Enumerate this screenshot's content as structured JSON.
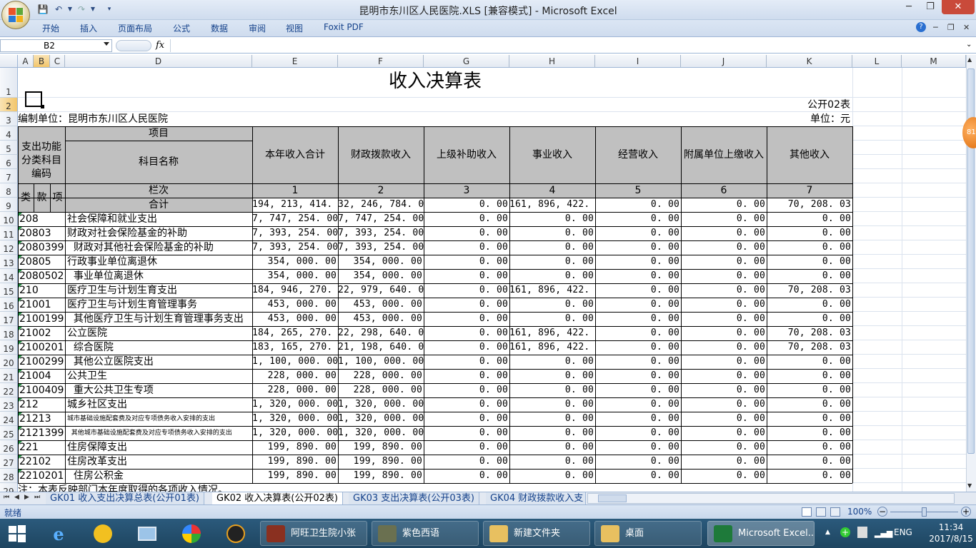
{
  "window": {
    "title": "昆明市东川区人民医院.XLS  [兼容模式] - Microsoft Excel"
  },
  "ribbon": {
    "tabs": [
      "开始",
      "插入",
      "页面布局",
      "公式",
      "数据",
      "审阅",
      "视图",
      "Foxit PDF"
    ]
  },
  "formula_bar": {
    "name_box": "B2",
    "fx_label": "fx",
    "formula": ""
  },
  "columns": [
    "A",
    "B",
    "C",
    "D",
    "E",
    "F",
    "G",
    "H",
    "I",
    "J",
    "K",
    "L",
    "M"
  ],
  "selected_cell": {
    "column": "B",
    "row": "2"
  },
  "sheet": {
    "title": "收入决算表",
    "code": "公开02表",
    "org": "编制单位：昆明市东川区人民医院",
    "unit": "单位：元",
    "header": {
      "item": "项目",
      "func_code": "支出功能分类科目编码",
      "subject_name": "科目名称",
      "lei": "类",
      "kuan": "款",
      "xiang": "项",
      "lanci": "栏次",
      "heji": "合计",
      "cols": [
        "本年收入合计",
        "财政拨款收入",
        "上级补助收入",
        "事业收入",
        "经营收入",
        "附属单位上缴收入",
        "其他收入"
      ],
      "col_nums": [
        "1",
        "2",
        "3",
        "4",
        "5",
        "6",
        "7"
      ]
    },
    "total_row": [
      "194, 213, 414. 50",
      "32, 246, 784. 00",
      "0. 00",
      "161, 896, 422. 47",
      "0. 00",
      "0. 00",
      "70, 208. 03"
    ],
    "rows": [
      {
        "code": "208",
        "name": "社会保障和就业支出",
        "vals": [
          "7, 747, 254. 00",
          "7, 747, 254. 00",
          "0. 00",
          "0. 00",
          "0. 00",
          "0. 00",
          "0. 00"
        ]
      },
      {
        "code": "20803",
        "name": "财政对社会保险基金的补助",
        "vals": [
          "7, 393, 254. 00",
          "7, 393, 254. 00",
          "0. 00",
          "0. 00",
          "0. 00",
          "0. 00",
          "0. 00"
        ]
      },
      {
        "code": "2080399",
        "name": "  财政对其他社会保险基金的补助",
        "vals": [
          "7, 393, 254. 00",
          "7, 393, 254. 00",
          "0. 00",
          "0. 00",
          "0. 00",
          "0. 00",
          "0. 00"
        ]
      },
      {
        "code": "20805",
        "name": "行政事业单位离退休",
        "vals": [
          "354, 000. 00",
          "354, 000. 00",
          "0. 00",
          "0. 00",
          "0. 00",
          "0. 00",
          "0. 00"
        ]
      },
      {
        "code": "2080502",
        "name": "  事业单位离退休",
        "vals": [
          "354, 000. 00",
          "354, 000. 00",
          "0. 00",
          "0. 00",
          "0. 00",
          "0. 00",
          "0. 00"
        ]
      },
      {
        "code": "210",
        "name": "医疗卫生与计划生育支出",
        "vals": [
          "184, 946, 270. 50",
          "22, 979, 640. 00",
          "0. 00",
          "161, 896, 422. 47",
          "0. 00",
          "0. 00",
          "70, 208. 03"
        ]
      },
      {
        "code": "21001",
        "name": "医疗卫生与计划生育管理事务",
        "vals": [
          "453, 000. 00",
          "453, 000. 00",
          "0. 00",
          "0. 00",
          "0. 00",
          "0. 00",
          "0. 00"
        ]
      },
      {
        "code": "2100199",
        "name": "  其他医疗卫生与计划生育管理事务支出",
        "vals": [
          "453, 000. 00",
          "453, 000. 00",
          "0. 00",
          "0. 00",
          "0. 00",
          "0. 00",
          "0. 00"
        ]
      },
      {
        "code": "21002",
        "name": "公立医院",
        "vals": [
          "184, 265, 270. 50",
          "22, 298, 640. 00",
          "0. 00",
          "161, 896, 422. 47",
          "0. 00",
          "0. 00",
          "70, 208. 03"
        ]
      },
      {
        "code": "2100201",
        "name": "  综合医院",
        "vals": [
          "183, 165, 270. 50",
          "21, 198, 640. 00",
          "0. 00",
          "161, 896, 422. 47",
          "0. 00",
          "0. 00",
          "70, 208. 03"
        ]
      },
      {
        "code": "2100299",
        "name": "  其他公立医院支出",
        "vals": [
          "1, 100, 000. 00",
          "1, 100, 000. 00",
          "0. 00",
          "0. 00",
          "0. 00",
          "0. 00",
          "0. 00"
        ]
      },
      {
        "code": "21004",
        "name": "公共卫生",
        "vals": [
          "228, 000. 00",
          "228, 000. 00",
          "0. 00",
          "0. 00",
          "0. 00",
          "0. 00",
          "0. 00"
        ]
      },
      {
        "code": "2100409",
        "name": "  重大公共卫生专项",
        "vals": [
          "228, 000. 00",
          "228, 000. 00",
          "0. 00",
          "0. 00",
          "0. 00",
          "0. 00",
          "0. 00"
        ]
      },
      {
        "code": "212",
        "name": "城乡社区支出",
        "vals": [
          "1, 320, 000. 00",
          "1, 320, 000. 00",
          "0. 00",
          "0. 00",
          "0. 00",
          "0. 00",
          "0. 00"
        ]
      },
      {
        "code": "21213",
        "name": "城市基础设施配套费及对应专项债务收入安排的支出",
        "small": true,
        "vals": [
          "1, 320, 000. 00",
          "1, 320, 000. 00",
          "0. 00",
          "0. 00",
          "0. 00",
          "0. 00",
          "0. 00"
        ]
      },
      {
        "code": "2121399",
        "name": "  其他城市基础设施配套费及对应专项债务收入安排的支出",
        "small": true,
        "vals": [
          "1, 320, 000. 00",
          "1, 320, 000. 00",
          "0. 00",
          "0. 00",
          "0. 00",
          "0. 00",
          "0. 00"
        ]
      },
      {
        "code": "221",
        "name": "住房保障支出",
        "vals": [
          "199, 890. 00",
          "199, 890. 00",
          "0. 00",
          "0. 00",
          "0. 00",
          "0. 00",
          "0. 00"
        ]
      },
      {
        "code": "22102",
        "name": "住房改革支出",
        "vals": [
          "199, 890. 00",
          "199, 890. 00",
          "0. 00",
          "0. 00",
          "0. 00",
          "0. 00",
          "0. 00"
        ]
      },
      {
        "code": "2210201",
        "name": "  住房公积金",
        "vals": [
          "199, 890. 00",
          "199, 890. 00",
          "0. 00",
          "0. 00",
          "0. 00",
          "0. 00",
          "0. 00"
        ]
      }
    ],
    "note": "注：本表反映部门本年度取得的各项收入情况。"
  },
  "row_numbers": [
    "1",
    "2",
    "3",
    "4",
    "5",
    "6",
    "7",
    "8",
    "9",
    "10",
    "11",
    "12",
    "13",
    "14",
    "15",
    "16",
    "17",
    "18",
    "19",
    "20",
    "21",
    "22",
    "23",
    "24",
    "25",
    "26",
    "27",
    "28",
    "29"
  ],
  "sheet_tabs": [
    "GK01 收入支出决算总表(公开01表)",
    "GK02 收入决算表(公开02表)",
    "GK03 支出决算表(公开03表)",
    "GK04 财政拨款收入支"
  ],
  "active_sheet_tab": 1,
  "status": {
    "ready": "就绪",
    "zoom": "100%"
  },
  "taskbar": {
    "tasks": [
      "阿旺卫生院小张",
      "紫色西语",
      "新建文件夹",
      "桌面",
      "Microsoft Excel..."
    ],
    "lang": "ENG",
    "time": "11:34",
    "date": "2017/8/15",
    "badge": "81"
  }
}
